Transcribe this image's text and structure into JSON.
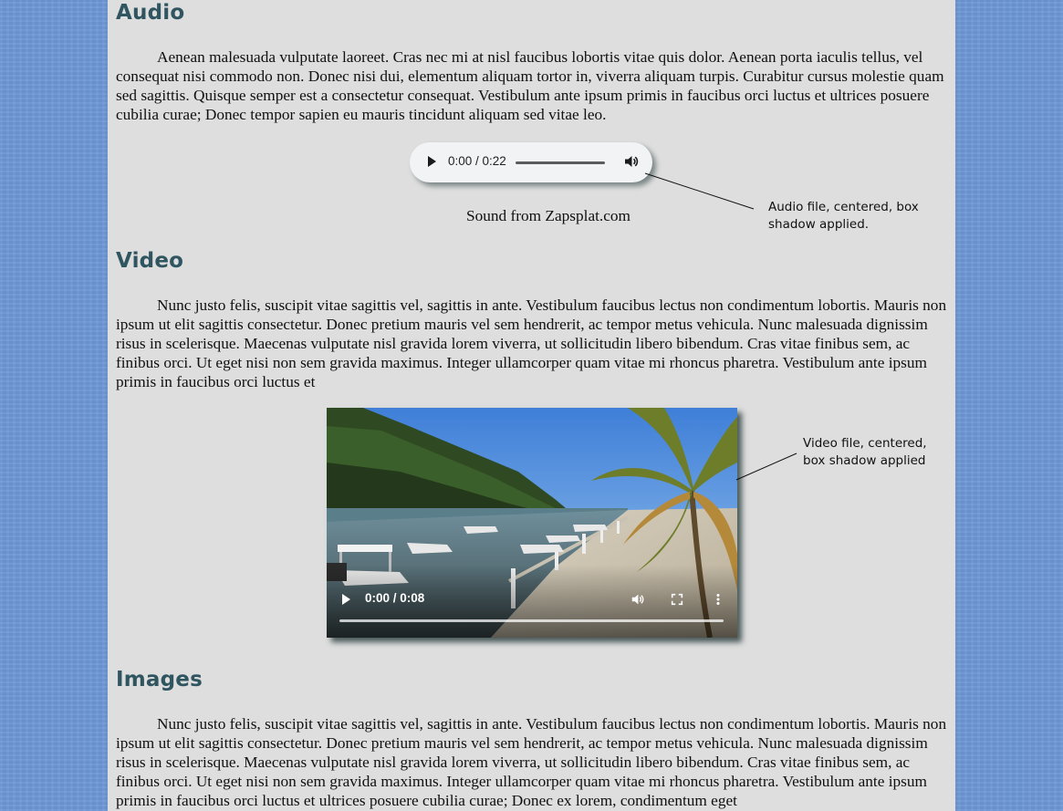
{
  "audio_section": {
    "heading": "Audio",
    "paragraph": "Aenean malesuada vulputate laoreet. Cras nec mi at nisl faucibus lobortis vitae quis dolor. Aenean porta iaculis tellus, vel consequat nisi commodo non. Donec nisi dui, elementum aliquam tortor in, viverra aliquam turpis. Curabitur cursus molestie quam sed sagittis. Quisque semper est a consectetur consequat. Vestibulum ante ipsum primis in faucibus orci luctus et ultrices posuere cubilia curae; Donec tempor sapien eu mauris tincidunt aliquam sed vitae leo.",
    "player": {
      "time": "0:00 / 0:22",
      "play_icon": "play-icon",
      "volume_icon": "volume-icon"
    },
    "caption": "Sound from Zapsplat.com",
    "annotation_line1": "Audio file, centered, box",
    "annotation_line2": "shadow applied."
  },
  "video_section": {
    "heading": "Video",
    "paragraph": "Nunc justo felis, suscipit vitae sagittis vel, sagittis in ante. Vestibulum faucibus lectus non condimentum lobortis. Mauris non ipsum ut elit sagittis consectetur. Donec pretium mauris vel sem hendrerit, ac tempor metus vehicula. Nunc malesuada dignissim risus in scelerisque. Maecenas vulputate nisl gravida lorem viverra, ut sollicitudin libero bibendum. Cras vitae finibus sem, ac finibus orci. Ut eget nisi non sem gravida maximus. Integer ullamcorper quam vitae mi rhoncus pharetra. Vestibulum ante ipsum primis in faucibus orci luctus et",
    "player": {
      "time": "0:00 / 0:08",
      "play_icon": "play-icon",
      "volume_icon": "volume-icon",
      "fullscreen_icon": "fullscreen-icon",
      "more_icon": "more-options-icon"
    },
    "annotation_line1": "Video file, centered,",
    "annotation_line2": "box shadow applied"
  },
  "images_section": {
    "heading": "Images",
    "paragraph": "Nunc justo felis, suscipit vitae sagittis vel, sagittis in ante. Vestibulum faucibus lectus non condimentum lobortis. Mauris non ipsum ut elit sagittis consectetur. Donec pretium mauris vel sem hendrerit, ac tempor metus vehicula. Nunc malesuada dignissim risus in scelerisque. Maecenas vulputate nisl gravida lorem viverra, ut sollicitudin libero bibendum. Cras vitae finibus sem, ac finibus orci. Ut eget nisi non sem gravida maximus. Integer ullamcorper quam vitae mi rhoncus pharetra. Vestibulum ante ipsum primis in faucibus orci luctus et ultrices posuere cubilia curae; Donec ex lorem, condimentum eget"
  },
  "colors": {
    "page_background": "#6e98d6",
    "content_background": "#dedede",
    "heading_color": "#2f5560"
  }
}
